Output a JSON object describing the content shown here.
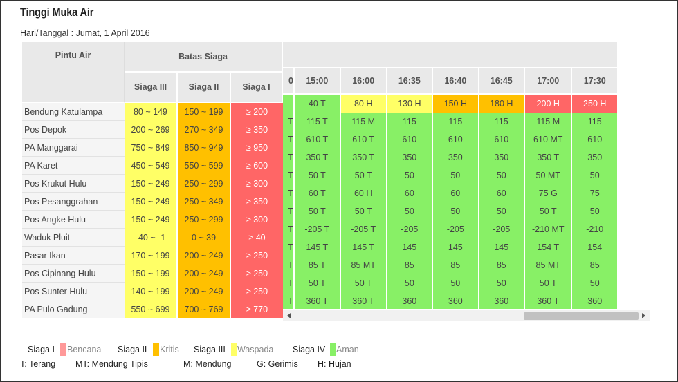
{
  "title": "Tinggi Muka Air",
  "date_line": "Hari/Tanggal : Jumat, 1 April 2016",
  "headers": {
    "pintu_air": "Pintu Air",
    "batas_siaga": "Batas Siaga",
    "siaga3": "Siaga III",
    "siaga2": "Siaga II",
    "siaga1": "Siaga I",
    "times": [
      "0",
      "15:00",
      "16:00",
      "16:35",
      "16:40",
      "16:45",
      "17:00",
      "17:30"
    ]
  },
  "rows": [
    {
      "name": "Bendung Katulampa",
      "s3": "80 ~ 149",
      "s2": "150 ~ 199",
      "s1": "≥ 200",
      "vals": [
        "",
        "40 T",
        "80 H",
        "130 H",
        "150 H",
        "180 H",
        "200 H",
        "250 H"
      ],
      "colors": [
        "green",
        "green",
        "yellow",
        "yellow",
        "orange",
        "orange",
        "red",
        "red"
      ]
    },
    {
      "name": "Pos Depok",
      "s3": "200 ~ 269",
      "s2": "270 ~ 349",
      "s1": "≥ 350",
      "vals": [
        "T",
        "115 T",
        "115 M",
        "115",
        "115",
        "115",
        "115 M",
        "115"
      ],
      "colors": [
        "green",
        "green",
        "green",
        "green",
        "green",
        "green",
        "green",
        "green"
      ]
    },
    {
      "name": "PA Manggarai",
      "s3": "750 ~ 849",
      "s2": "850 ~ 949",
      "s1": "≥ 950",
      "vals": [
        "T",
        "610 T",
        "610 T",
        "610",
        "610",
        "610",
        "610 MT",
        "610"
      ],
      "colors": [
        "green",
        "green",
        "green",
        "green",
        "green",
        "green",
        "green",
        "green"
      ]
    },
    {
      "name": "PA Karet",
      "s3": "450 ~ 549",
      "s2": "550 ~ 599",
      "s1": "≥ 600",
      "vals": [
        "T",
        "350 T",
        "350 T",
        "350",
        "350",
        "350",
        "350 T",
        "350"
      ],
      "colors": [
        "green",
        "green",
        "green",
        "green",
        "green",
        "green",
        "green",
        "green"
      ]
    },
    {
      "name": "Pos Krukut Hulu",
      "s3": "150 ~ 249",
      "s2": "250 ~ 299",
      "s1": "≥ 300",
      "vals": [
        "T",
        "50 T",
        "50 T",
        "50",
        "50",
        "50",
        "50 MT",
        "50"
      ],
      "colors": [
        "green",
        "green",
        "green",
        "green",
        "green",
        "green",
        "green",
        "green"
      ]
    },
    {
      "name": "Pos Pesanggrahan",
      "s3": "150 ~ 249",
      "s2": "250 ~ 349",
      "s1": "≥ 350",
      "vals": [
        "T",
        "60 T",
        "60 H",
        "60",
        "60",
        "60",
        "75 G",
        "75"
      ],
      "colors": [
        "green",
        "green",
        "green",
        "green",
        "green",
        "green",
        "green",
        "green"
      ]
    },
    {
      "name": "Pos Angke Hulu",
      "s3": "150 ~ 249",
      "s2": "250 ~ 299",
      "s1": "≥ 300",
      "vals": [
        "T",
        "50 T",
        "50 T",
        "50",
        "50",
        "50",
        "50 T",
        "50"
      ],
      "colors": [
        "green",
        "green",
        "green",
        "green",
        "green",
        "green",
        "green",
        "green"
      ]
    },
    {
      "name": "Waduk Pluit",
      "s3": "-40 ~ -1",
      "s2": "0 ~ 39",
      "s1": "≥ 40",
      "vals": [
        "T",
        "-205 T",
        "-205 T",
        "-205",
        "-205",
        "-205",
        "-210 MT",
        "-210"
      ],
      "colors": [
        "green",
        "green",
        "green",
        "green",
        "green",
        "green",
        "green",
        "green"
      ]
    },
    {
      "name": "Pasar Ikan",
      "s3": "170 ~ 199",
      "s2": "200 ~ 249",
      "s1": "≥ 250",
      "vals": [
        "T",
        "145 T",
        "145 T",
        "145",
        "145",
        "145",
        "154 T",
        "154"
      ],
      "colors": [
        "green",
        "green",
        "green",
        "green",
        "green",
        "green",
        "green",
        "green"
      ]
    },
    {
      "name": "Pos Cipinang Hulu",
      "s3": "150 ~ 199",
      "s2": "200 ~ 249",
      "s1": "≥ 250",
      "vals": [
        "T",
        "85 T",
        "85 MT",
        "85",
        "85",
        "85",
        "85 MT",
        "85"
      ],
      "colors": [
        "green",
        "green",
        "green",
        "green",
        "green",
        "green",
        "green",
        "green"
      ]
    },
    {
      "name": "Pos Sunter Hulu",
      "s3": "140 ~ 199",
      "s2": "200 ~ 249",
      "s1": "≥ 250",
      "vals": [
        "T",
        "50 T",
        "50 T",
        "50",
        "50",
        "50",
        "50 T",
        "50"
      ],
      "colors": [
        "green",
        "green",
        "green",
        "green",
        "green",
        "green",
        "green",
        "green"
      ]
    },
    {
      "name": "PA Pulo Gadung",
      "s3": "550 ~ 699",
      "s2": "700 ~ 769",
      "s1": "≥ 770",
      "vals": [
        "T",
        "360 T",
        "360 T",
        "360",
        "360",
        "360",
        "360 T",
        "360"
      ],
      "colors": [
        "green",
        "green",
        "green",
        "green",
        "green",
        "green",
        "green",
        "green"
      ]
    }
  ],
  "legend": {
    "siaga1": "Siaga I",
    "siaga1_desc": "Bencana",
    "siaga1_color": "#ff9999",
    "siaga2": "Siaga II",
    "siaga2_desc": "Kritis",
    "siaga2_color": "#ffc000",
    "siaga3": "Siaga III",
    "siaga3_desc": "Waspada",
    "siaga3_color": "#ffff66",
    "siaga4": "Siaga IV",
    "siaga4_desc": "Aman",
    "siaga4_color": "#88f066"
  },
  "weather_legend": {
    "t": "T: Terang",
    "mt": "MT: Mendung Tipis",
    "m": "M: Mendung",
    "g": "G: Gerimis",
    "h": "H: Hujan"
  }
}
